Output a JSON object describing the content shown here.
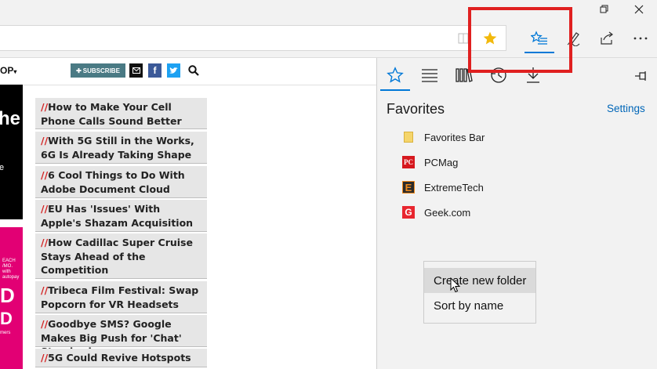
{
  "toolbar": {
    "favorites_hub_icon": "favorites-hub-icon",
    "add_favorite_icon": "star-icon",
    "highlight_color": "#e02020"
  },
  "site": {
    "nav_fragment": "OP",
    "subscribe_label": "SUBSCRIBE",
    "hero_text_1": "he",
    "hero_text_2": "e",
    "ad_line_1": "EACH",
    "ad_line_2": "/MO.",
    "ad_line_3": "with",
    "ad_line_4": "autopay",
    "ad_big_1": "D",
    "ad_big_2": "D",
    "ad_small": "mers",
    "headline_prefix": "//",
    "headlines": [
      "How to Make Your Cell Phone Calls Sound Better",
      "With 5G Still in the Works, 6G Is Already Taking Shape",
      "6 Cool Things to Do With Adobe Document Cloud",
      "EU Has 'Issues' With Apple's Shazam Acquisition",
      "How Cadillac Super Cruise Stays Ahead of the Competition",
      "Tribeca Film Festival: Swap Popcorn for VR Headsets",
      "Goodbye SMS? Google Makes Big Push for 'Chat' Standard",
      "5G Could Revive Hotspots"
    ]
  },
  "favorites": {
    "title": "Favorites",
    "settings_label": "Settings",
    "items": [
      {
        "label": "Favorites Bar",
        "icon": "folder-icon"
      },
      {
        "label": "PCMag",
        "icon": "pcmag-icon"
      },
      {
        "label": "ExtremeTech",
        "icon": "extremetech-icon"
      },
      {
        "label": "Geek.com",
        "icon": "geek-icon"
      }
    ]
  },
  "context_menu": {
    "items": [
      "Create new folder",
      "Sort by name"
    ]
  },
  "colors": {
    "accent": "#0078d7",
    "subscribe": "#4a7a84",
    "ad_magenta": "#e20074",
    "headline_bg": "#e6e6e6",
    "headline_slash": "#d32323"
  }
}
